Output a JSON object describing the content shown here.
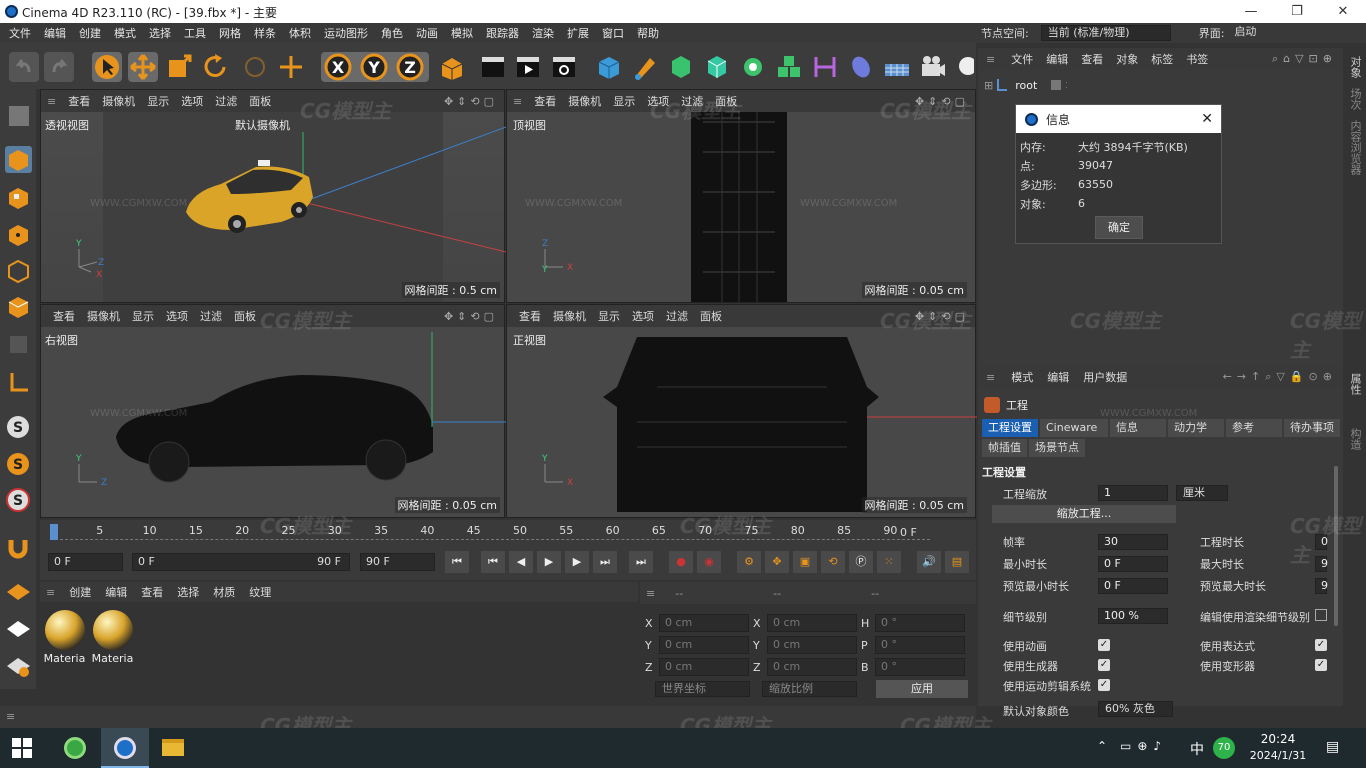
{
  "window": {
    "title": "Cinema 4D R23.110 (RC) - [39.fbx *] - 主要"
  },
  "menu": [
    "文件",
    "编辑",
    "创建",
    "模式",
    "选择",
    "工具",
    "网格",
    "样条",
    "体积",
    "运动图形",
    "角色",
    "动画",
    "模拟",
    "跟踪器",
    "渲染",
    "扩展",
    "窗口",
    "帮助"
  ],
  "top_right": {
    "node_space_label": "节点空间:",
    "node_space_value": "当前 (标准/物理)",
    "layout_label": "界面:",
    "layout_value": "启动"
  },
  "viewport_menu": [
    "查看",
    "摄像机",
    "显示",
    "选项",
    "过滤",
    "面板"
  ],
  "viewports": [
    {
      "title": "透视视图",
      "grid": "网格间距 : 0.5 cm",
      "camera": "默认摄像机"
    },
    {
      "title": "顶视图",
      "grid": "网格间距 : 0.05 cm"
    },
    {
      "title": "右视图",
      "grid": "网格间距 : 0.05 cm"
    },
    {
      "title": "正视图",
      "grid": "网格间距 : 0.05 cm"
    }
  ],
  "timeline": {
    "ticks": [
      "0",
      "5",
      "10",
      "15",
      "20",
      "25",
      "30",
      "35",
      "40",
      "45",
      "50",
      "55",
      "60",
      "65",
      "70",
      "75",
      "80",
      "85",
      "90"
    ],
    "end_frame": "0 F",
    "current": "0 F",
    "range_start": "0 F",
    "range_end": "90 F",
    "max": "90 F"
  },
  "material_panel": {
    "menu": [
      "创建",
      "编辑",
      "查看",
      "选择",
      "材质",
      "纹理"
    ],
    "materials": [
      "Materia",
      "Materia"
    ]
  },
  "coord_panel": {
    "header": [
      "--",
      "--",
      "--"
    ],
    "rows": [
      [
        "X",
        "0 cm",
        "X",
        "0 cm",
        "H",
        "0 °"
      ],
      [
        "Y",
        "0 cm",
        "Y",
        "0 cm",
        "P",
        "0 °"
      ],
      [
        "Z",
        "0 cm",
        "Z",
        "0 cm",
        "B",
        "0 °"
      ]
    ],
    "world": "世界坐标",
    "scale": "缩放比例",
    "apply": "应用"
  },
  "object_panel": {
    "menu": [
      "文件",
      "编辑",
      "查看",
      "对象",
      "标签",
      "书签"
    ],
    "root": "root"
  },
  "info_dialog": {
    "title": "信息",
    "rows": [
      [
        "内存:",
        "大约 3894千字节(KB)"
      ],
      [
        "点:",
        "39047"
      ],
      [
        "多边形:",
        "63550"
      ],
      [
        "对象:",
        "6"
      ]
    ],
    "ok": "确定"
  },
  "attr_panel": {
    "menu": [
      "模式",
      "编辑",
      "用户数据"
    ],
    "object": "工程",
    "tabs": [
      "工程设置",
      "Cineware",
      "信息",
      "动力学",
      "参考",
      "待办事项"
    ],
    "tabs2": [
      "帧插值",
      "场景节点"
    ],
    "section": "工程设置",
    "scale_label": "工程缩放",
    "scale_value": "1",
    "scale_unit": "厘米",
    "scale_btn": "缩放工程...",
    "fields": [
      [
        "帧率",
        "30",
        "工程时长",
        "0"
      ],
      [
        "最小时长",
        "0 F",
        "最大时长",
        "9"
      ],
      [
        "预览最小时长",
        "0 F",
        "预览最大时长",
        "9"
      ]
    ],
    "lod_label": "细节级别",
    "lod_value": "100 %",
    "lod_right": "编辑使用渲染细节级别",
    "checks": [
      [
        "使用动画",
        "使用表达式"
      ],
      [
        "使用生成器",
        "使用变形器"
      ],
      [
        "使用运动剪辑系统",
        ""
      ]
    ],
    "default_color_label": "默认对象颜色",
    "default_color_value": "60% 灰色"
  },
  "side_tabs": [
    "对象",
    "场次",
    "内容浏览器",
    "层",
    "属性",
    "构造"
  ],
  "taskbar": {
    "time": "20:24",
    "date": "2024/1/31",
    "ime": "中",
    "badge": "70"
  },
  "watermark": "CG模型主",
  "watermark_url": "WWW.CGMXW.COM"
}
